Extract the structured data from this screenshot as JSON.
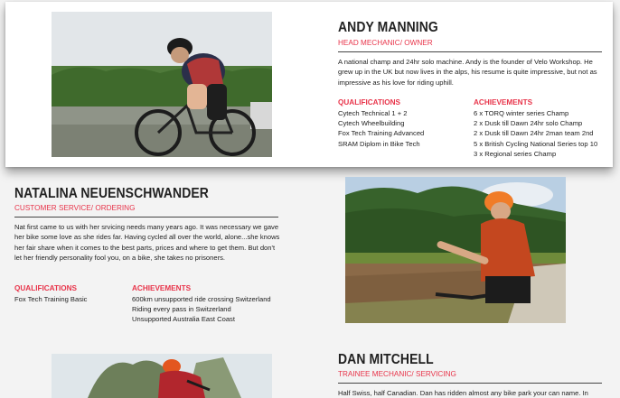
{
  "team": [
    {
      "name": "ANDY MANNING",
      "role": "HEAD MECHANIC/ OWNER",
      "bio": "A national champ and 24hr solo machine. Andy is the founder of Velo Workshop. He grew up in the UK but now lives in the alps, his resume is quite impressive, but not as impressive as his love for riding uphill.",
      "qualifications_heading": "QUALIFICATIONS",
      "qualifications": [
        "Cytech Technical 1 + 2",
        "Cytech Wheelbuilding",
        "Fox Tech Training Advanced",
        "SRAM Diplom in Bike Tech"
      ],
      "achievements_heading": "ACHIEVEMENTS",
      "achievements": [
        "6 x TORQ winter series Champ",
        "2 x Dusk till Dawn 24hr solo Champ",
        "2 x Dusk till Dawn 24hr 2man team 2nd",
        "5 x British Cycling National Series top 10",
        "3 x Regional series Champ"
      ]
    },
    {
      "name": "NATALINA NEUENSCHWANDER",
      "role": "CUSTOMER SERVICE/ ORDERING",
      "bio": "Nat first came to us with her srvicing needs many years ago. It was necessary we gave her bike some love as she rides far. Having cycled all over the world, alone...she knows her fair share when it comes to the best parts, prices and where to get them. But don't let her friendly personality fool you, on a bike, she takes no prisoners.",
      "qualifications_heading": "QUALIFICATIONS",
      "qualifications": [
        "Fox Tech Training Basic"
      ],
      "achievements_heading": "ACHIEVEMENTS",
      "achievements": [
        "600km unsupported ride crossing Switzerland",
        "Riding every pass in Switzerland",
        "Unsupported Australia East Coast"
      ]
    },
    {
      "name": "DAN MITCHELL",
      "role": "TRAINEE MECHANIC/ SERVICING",
      "bio": "Half Swiss, half Canadian. Dan has ridden almost any bike park your can name. In"
    }
  ],
  "colors": {
    "accent": "#e8344a",
    "text": "#222222",
    "background": "#f3f3f3",
    "card": "#ffffff"
  }
}
